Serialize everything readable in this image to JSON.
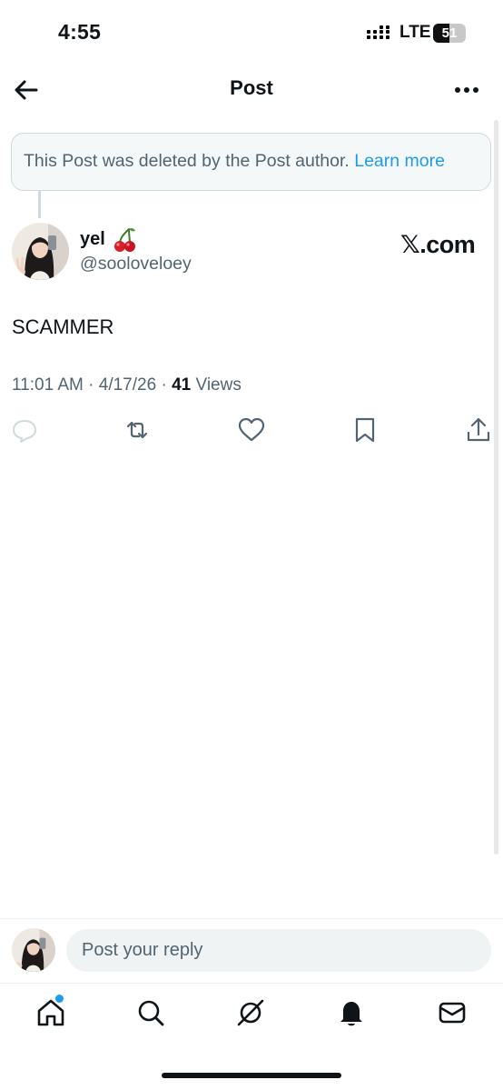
{
  "status_bar": {
    "time": "4:55",
    "network": "LTE",
    "battery_level": "51"
  },
  "header": {
    "title": "Post"
  },
  "deleted_notice": {
    "message": "This Post was deleted by the Post author.",
    "link_label": "Learn more"
  },
  "post": {
    "author_name": "yel",
    "author_emoji": "cherries",
    "author_handle": "@sooloveloey",
    "source": "𝕏.com",
    "text": "SCAMMER",
    "time": "11:01 AM",
    "date": "4/17/26",
    "view_count": "41",
    "views_label": "Views"
  },
  "actions": [
    "reply-icon",
    "repost-icon",
    "like-icon",
    "bookmark-icon",
    "share-icon"
  ],
  "composer": {
    "placeholder": "Post your reply"
  },
  "tab_bar": [
    "home-icon",
    "search-icon",
    "grok-icon",
    "notifications-icon",
    "messages-icon"
  ],
  "colors": {
    "accent": "#1d9bf0",
    "text_primary": "#0f1419",
    "text_secondary": "#536471",
    "border": "#cfd9de",
    "notice_bg": "#f5f8f8"
  }
}
